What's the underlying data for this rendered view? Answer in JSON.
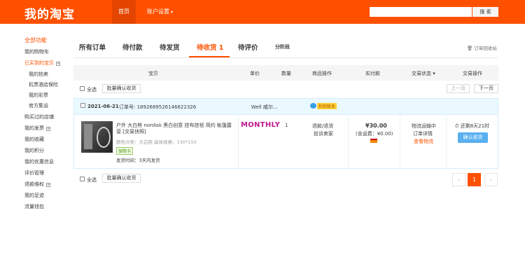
{
  "header": {
    "logo": "我的淘宝",
    "nav_home": "首页",
    "nav_account": "账户设置",
    "search_placeholder": "",
    "search_button": "搜 索"
  },
  "sidebar": {
    "all_label": "全部功能",
    "items": [
      {
        "label": "我的购物车"
      },
      {
        "label": "已买到的宝贝"
      },
      {
        "label": "我的拍卖"
      },
      {
        "label": "机票酒店保险"
      },
      {
        "label": "我的彩票"
      },
      {
        "label": "官方集运"
      },
      {
        "label": "购买过的店铺"
      },
      {
        "label": "我的发票"
      },
      {
        "label": "我的收藏"
      },
      {
        "label": "我的积分"
      },
      {
        "label": "我的优惠信息"
      },
      {
        "label": "评价管理"
      },
      {
        "label": "退款维权"
      },
      {
        "label": "我的足迹"
      },
      {
        "label": "流量钱包"
      }
    ]
  },
  "tabs": [
    {
      "label": "所有订单"
    },
    {
      "label": "待付款"
    },
    {
      "label": "待发货"
    },
    {
      "label": "待收货 1"
    },
    {
      "label": "待评价"
    },
    {
      "label": "分阶段"
    }
  ],
  "recycle_label": "订单回收站",
  "columns": [
    "宝贝",
    "单价",
    "数量",
    "商品操作",
    "实付款",
    "交易状态",
    "交易操作"
  ],
  "batch": {
    "select_all": "全选",
    "confirm_button": "批量确认收货",
    "prev_page": "上一页",
    "next_page": "下一页"
  },
  "order": {
    "date": "2021-06-21",
    "order_no": "订单号: 1892689526146622326",
    "seller": "Well 威尔...",
    "contact": "和我联系",
    "product_title": "户外 大白熊 nordisk 黑白创意 挂布挂毯 简约 帐篷露营 [交易快照]",
    "sku": "颜色分类：大白熊  具体规格：130*150",
    "guarantee": "保障卡",
    "ship_time": "发货时间：3天内发货",
    "brand": "MONTHLY",
    "quantity": "1",
    "op_refund": "退款/退货",
    "op_complain": "投诉卖家",
    "price": "¥30.00",
    "freight": "(含运费：¥0.00)",
    "status_line1": "物流运输中",
    "status_line2": "订单详情",
    "status_link": "查看物流",
    "remaining": "还剩8天21时",
    "confirm": "确认收货"
  },
  "pagination": {
    "prev": "‹",
    "current": "1",
    "next": "›"
  },
  "colors": {
    "brand": "#ff5000",
    "confirm": "#5ab0f0"
  }
}
